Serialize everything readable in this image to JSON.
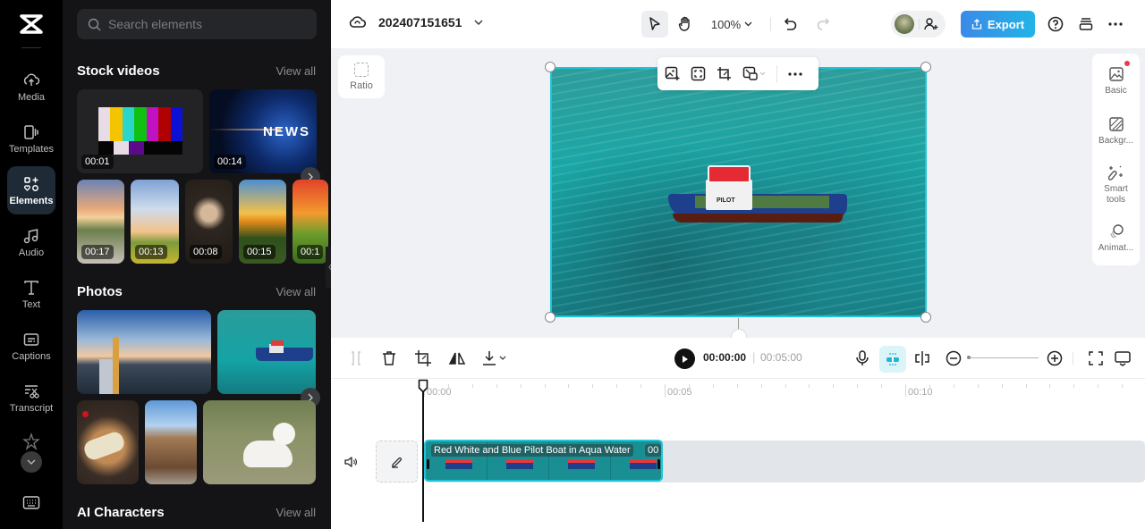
{
  "rail": {
    "items": [
      {
        "label": "Media",
        "icon": "cloud-upload-icon"
      },
      {
        "label": "Templates",
        "icon": "templates-icon"
      },
      {
        "label": "Elements",
        "icon": "elements-icon",
        "active": true
      },
      {
        "label": "Audio",
        "icon": "music-note-icon"
      },
      {
        "label": "Text",
        "icon": "text-icon"
      },
      {
        "label": "Captions",
        "icon": "captions-icon"
      },
      {
        "label": "Transcript",
        "icon": "transcript-icon"
      }
    ]
  },
  "panel": {
    "search_placeholder": "Search elements",
    "stock_videos": {
      "title": "Stock videos",
      "view_all": "View all",
      "large": [
        {
          "duration": "00:01",
          "desc": "color bars"
        },
        {
          "duration": "00:14",
          "desc": "news globe"
        }
      ],
      "small": [
        {
          "duration": "00:17"
        },
        {
          "duration": "00:13"
        },
        {
          "duration": "00:08"
        },
        {
          "duration": "00:15"
        },
        {
          "duration": "00:1"
        }
      ]
    },
    "photos": {
      "title": "Photos",
      "view_all": "View all"
    },
    "ai_characters": {
      "title": "AI Characters",
      "view_all": "View all"
    }
  },
  "topbar": {
    "project_name": "202407151651",
    "zoom": "100%",
    "export_label": "Export"
  },
  "canvas": {
    "ratio_label": "Ratio",
    "boat_label": "PILOT"
  },
  "side_panel": {
    "items": [
      {
        "label": "Basic"
      },
      {
        "label": "Backgr..."
      },
      {
        "label": "Smart tools"
      },
      {
        "label": "Animat..."
      }
    ]
  },
  "timeline": {
    "current_time": "00:00:00",
    "separator": "|",
    "total_time": "00:05:00",
    "ruler": [
      "00:00",
      "00:05",
      "00:10"
    ],
    "clip": {
      "title": "Red White and Blue Pilot Boat in Aqua Water",
      "duration": "00"
    }
  },
  "colors": {
    "accent": "#1fc4d6",
    "export_start": "#3a8ae8",
    "export_end": "#22b4e6"
  }
}
